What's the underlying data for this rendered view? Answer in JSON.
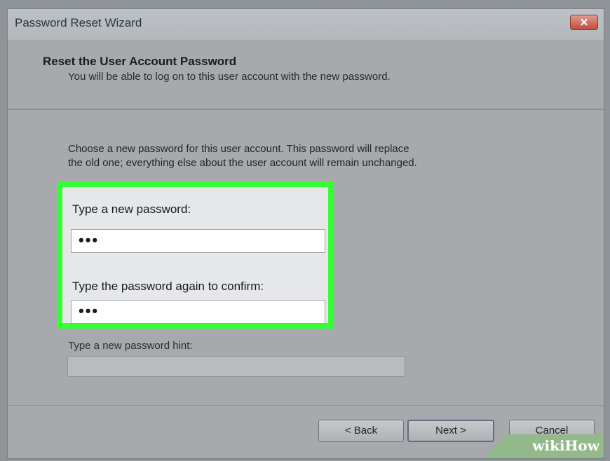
{
  "window": {
    "title": "Password Reset Wizard",
    "close_label": "✕"
  },
  "header": {
    "title": "Reset the User Account Password",
    "subtitle": "You will be able to log on to this user account with the new password."
  },
  "main": {
    "description_line1": "Choose a new password for this user account. This password will replace",
    "description_line2": "the old one; everything else about the user account will remain unchanged.",
    "new_password_label": "Type a new password:",
    "new_password_value": "•••",
    "confirm_password_label": "Type the password again to confirm:",
    "confirm_password_value": "•••",
    "hint_label": "Type a new password hint:",
    "hint_value": ""
  },
  "buttons": {
    "back": "< Back",
    "next": "Next >",
    "cancel": "Cancel"
  },
  "watermark": "wikiHow",
  "colors": {
    "highlight": "#33ff33",
    "close_button": "#c14c3c"
  }
}
